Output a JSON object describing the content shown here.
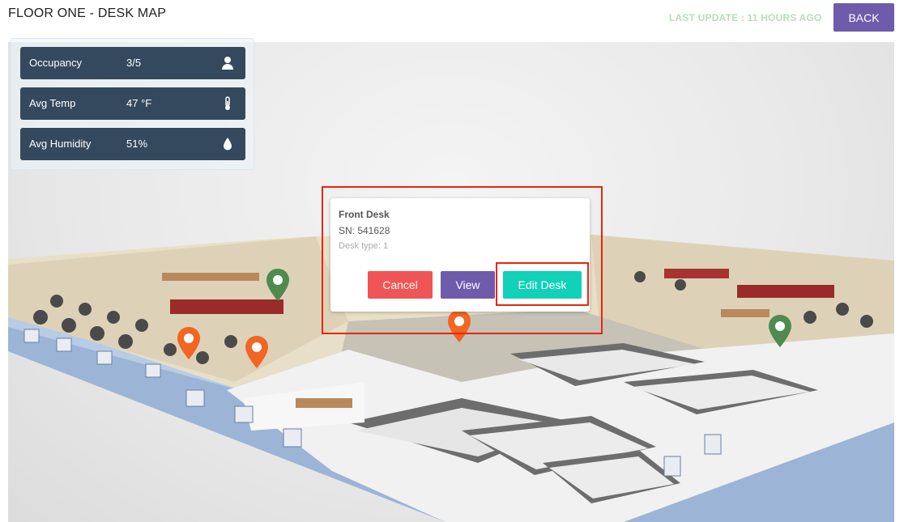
{
  "header": {
    "title": "FLOOR ONE - DESK MAP",
    "last_update": "LAST UPDATE : 11 HOURS AGO",
    "back_label": "BACK"
  },
  "stats": [
    {
      "label": "Occupancy",
      "value": "3/5",
      "icon": "person-icon"
    },
    {
      "label": "Avg Temp",
      "value": "47 °F",
      "icon": "thermometer-icon"
    },
    {
      "label": "Avg Humidity",
      "value": "51%",
      "icon": "droplet-icon"
    }
  ],
  "popup": {
    "title": "Front Desk",
    "sn": "SN: 541628",
    "desk_type": "Desk type: 1",
    "cancel_label": "Cancel",
    "view_label": "View",
    "edit_label": "Edit Desk"
  },
  "markers": [
    {
      "status": "available",
      "color": "#4f8a4f"
    },
    {
      "status": "occupied",
      "color": "#f26522"
    },
    {
      "status": "occupied",
      "color": "#f26522"
    },
    {
      "status": "occupied",
      "color": "#f26522"
    },
    {
      "status": "available",
      "color": "#4f8a4f"
    }
  ],
  "colors": {
    "accent": "#6f5bab",
    "panel": "#34495e",
    "cancel": "#f05555",
    "edit": "#11d1b8",
    "highlight": "#e8260c",
    "last_update": "#b5dfb9"
  }
}
